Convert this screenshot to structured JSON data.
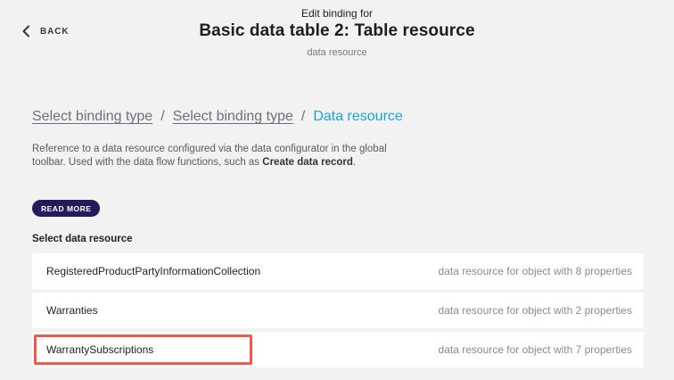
{
  "header": {
    "back_label": "BACK",
    "supertitle": "Edit binding for",
    "title": "Basic data table 2: Table resource",
    "subtitle": "data resource"
  },
  "breadcrumb": {
    "items": [
      {
        "label": "Select binding type"
      },
      {
        "label": "Select binding type"
      }
    ],
    "separator": "/",
    "current": "Data resource"
  },
  "description": {
    "text_before": "Reference to a data resource configured via the data configurator in the global toolbar. Used with the data flow functions, such as ",
    "bold": "Create data record",
    "text_after": "."
  },
  "read_more_label": "READ MORE",
  "section_label": "Select data resource",
  "resources": [
    {
      "name": "RegisteredProductPartyInformationCollection",
      "meta": "data resource for object with 8 properties"
    },
    {
      "name": "Warranties",
      "meta": "data resource for object with 2 properties"
    },
    {
      "name": "WarrantySubscriptions",
      "meta": "data resource for object with 7 properties"
    }
  ],
  "colors": {
    "accent": "#1aa3d9",
    "button_bg": "#241a5c",
    "highlight": "#ee5a4d",
    "background": "#f2f2f2"
  }
}
